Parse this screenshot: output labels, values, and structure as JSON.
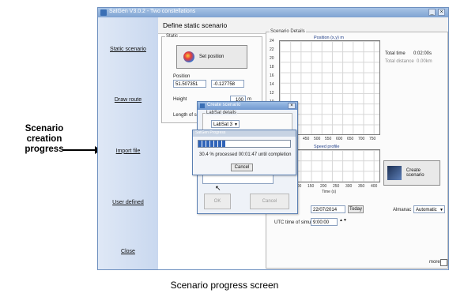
{
  "annotation": {
    "callout": "Scenario creation progress",
    "caption": "Scenario progress screen"
  },
  "window": {
    "title": "SatGen V3.0.2 - Two constellations",
    "header": "Define static scenario"
  },
  "sidebar": {
    "items": [
      {
        "label": "Static scenario"
      },
      {
        "label": "Draw route"
      },
      {
        "label": "Import file"
      },
      {
        "label": "User defined"
      },
      {
        "label": "Close"
      }
    ]
  },
  "static_group": {
    "label": "Static",
    "set_position_label": "Set position",
    "position_label": "Position",
    "latitude": "51.507351",
    "longitude": "-0.127758",
    "height_label": "Height",
    "height_value": "100",
    "height_unit": "m",
    "length_label": "Length of sce"
  },
  "details": {
    "label": "Scenario Details",
    "position_title": "Position (x,y) m",
    "speed_title": "Speed profile",
    "time_axis_label": "Time (s)",
    "total_time_label": "Total time",
    "total_time_value": "0:02:00s",
    "total_distance_label": "Total distance",
    "total_distance_value": "0.00km",
    "y_ticks": [
      "24",
      "22",
      "20",
      "18",
      "16",
      "14",
      "12",
      "10"
    ],
    "x_ticks_pos": [
      "400",
      "450",
      "500",
      "550",
      "600",
      "650",
      "700",
      "750"
    ],
    "x_ticks_speed": [
      "100",
      "150",
      "200",
      "250",
      "300",
      "350",
      "400"
    ],
    "create_scenario_label": "Create scenario",
    "start_label": "on",
    "start_date": "22/07/2014",
    "today_label": "Today",
    "almanac_label": "Almanac",
    "almanac_value": "Automatic",
    "utc_label": "UTC time of simulation",
    "utc_value": "9:00:00",
    "more_label": "more"
  },
  "create_dialog": {
    "title": "Create scenario",
    "group_label": "LabSat details",
    "select_value": "LabSat 3",
    "ok_label": "OK",
    "cancel_label": "Cancel"
  },
  "progress_dialog": {
    "title": "SatGen Progress",
    "progress_percent": 30.4,
    "status_text": "30.4 % processed 00:01:47 until completion",
    "cancel_label": "Cancel"
  },
  "colors": {
    "window_border": "#6d8fbf",
    "progress_fill": "#2f63b8",
    "sidebar": "#c9d8ef"
  }
}
